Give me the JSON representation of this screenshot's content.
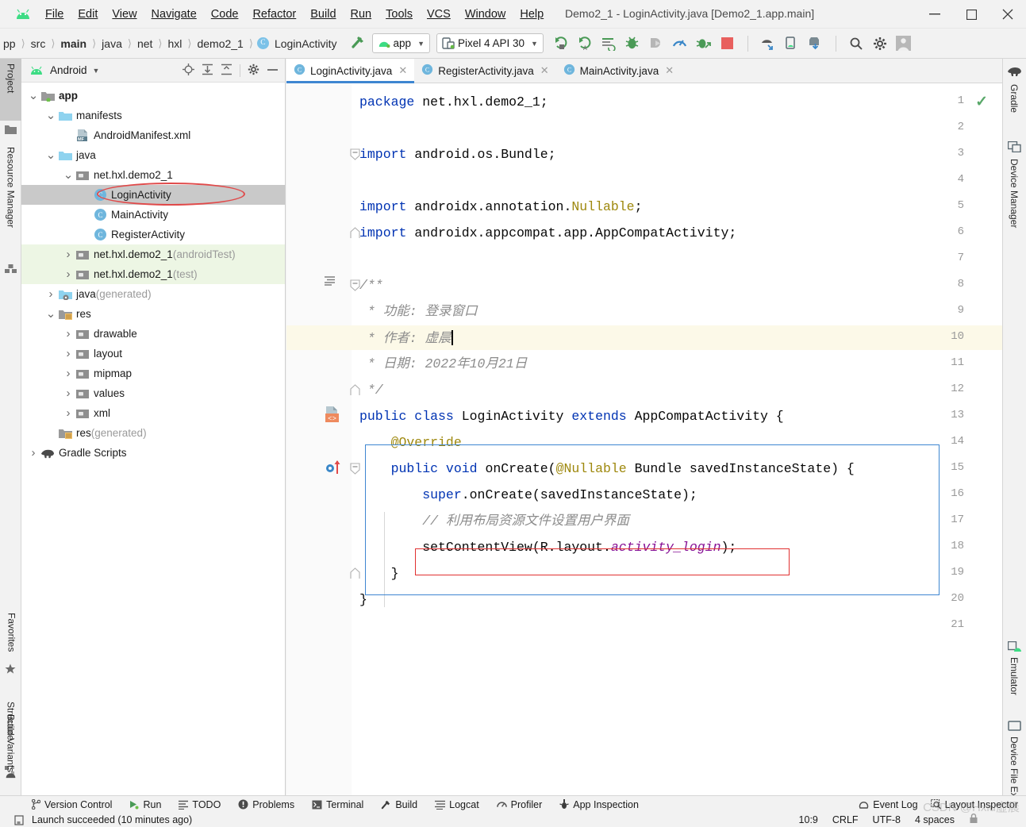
{
  "window": {
    "title": "Demo2_1 - LoginActivity.java [Demo2_1.app.main]",
    "minimize": "—",
    "maximize": "☐",
    "close": "✕"
  },
  "menubar": {
    "items": [
      {
        "label": "File"
      },
      {
        "label": "Edit"
      },
      {
        "label": "View"
      },
      {
        "label": "Navigate"
      },
      {
        "label": "Code"
      },
      {
        "label": "Refactor"
      },
      {
        "label": "Build"
      },
      {
        "label": "Run"
      },
      {
        "label": "Tools"
      },
      {
        "label": "VCS"
      },
      {
        "label": "Window"
      },
      {
        "label": "Help"
      }
    ]
  },
  "breadcrumb": {
    "items": [
      "pp",
      "src",
      "main",
      "java",
      "net",
      "hxl",
      "demo2_1",
      "LoginActivity"
    ],
    "class_badge": "C"
  },
  "toolbar": {
    "module_selector": "app",
    "device_selector": "Pixel 4 API 30",
    "icons": [
      "run-icon",
      "run-with-coverage-icon",
      "apply-changes-icon",
      "debug-icon",
      "attach-debugger-icon",
      "profiler-icon",
      "apply-code-changes-icon",
      "stop-icon",
      "sdk-manager-icon",
      "avd-manager-icon",
      "sync-gradle-icon",
      "search-icon",
      "settings-icon",
      "avatar-icon"
    ]
  },
  "left_tool_strip": {
    "tabs": [
      {
        "label": "Project",
        "icon": "project-icon",
        "selected": true
      },
      {
        "label": "Resource Manager",
        "icon": "resource-manager-icon",
        "selected": false
      },
      {
        "label": "Structure",
        "icon": "structure-icon",
        "selected": false
      },
      {
        "label": "Favorites",
        "icon": "star-icon",
        "selected": false
      },
      {
        "label": "Build Variants",
        "icon": "build-variants-icon",
        "selected": false
      }
    ]
  },
  "right_tool_strip": {
    "tabs": [
      {
        "label": "Gradle",
        "icon": "gradle-elephant-icon"
      },
      {
        "label": "Device Manager",
        "icon": "device-manager-icon"
      },
      {
        "label": "Emulator",
        "icon": "emulator-icon"
      },
      {
        "label": "Device File Explorer",
        "icon": "device-file-explorer-icon"
      }
    ]
  },
  "project_panel": {
    "header": {
      "title": "Android",
      "icons": [
        "locate-icon",
        "expand-all-icon",
        "collapse-all-icon",
        "gear-icon",
        "minimize-icon"
      ]
    },
    "tree": [
      {
        "label": "app",
        "suffix": "",
        "depth": 0,
        "arrow": "v",
        "icon": "module-folder-icon",
        "bold": true,
        "selected": false,
        "test": false
      },
      {
        "label": "manifests",
        "suffix": "",
        "depth": 1,
        "arrow": "v",
        "icon": "folder-icon",
        "bold": false,
        "selected": false,
        "test": false
      },
      {
        "label": "AndroidManifest.xml",
        "suffix": "",
        "depth": 2,
        "arrow": "",
        "icon": "manifest-file-icon",
        "bold": false,
        "selected": false,
        "test": false
      },
      {
        "label": "java",
        "suffix": "",
        "depth": 1,
        "arrow": "v",
        "icon": "folder-icon",
        "bold": false,
        "selected": false,
        "test": false
      },
      {
        "label": "net.hxl.demo2_1",
        "suffix": "",
        "depth": 2,
        "arrow": "v",
        "icon": "package-icon",
        "bold": false,
        "selected": false,
        "test": false
      },
      {
        "label": "LoginActivity",
        "suffix": "",
        "depth": 3,
        "arrow": "",
        "icon": "class-icon",
        "bold": false,
        "selected": true,
        "test": false
      },
      {
        "label": "MainActivity",
        "suffix": "",
        "depth": 3,
        "arrow": "",
        "icon": "class-icon",
        "bold": false,
        "selected": false,
        "test": false
      },
      {
        "label": "RegisterActivity",
        "suffix": "",
        "depth": 3,
        "arrow": "",
        "icon": "class-icon",
        "bold": false,
        "selected": false,
        "test": false
      },
      {
        "label": "net.hxl.demo2_1",
        "suffix": " (androidTest)",
        "depth": 2,
        "arrow": ">",
        "icon": "package-icon",
        "bold": false,
        "selected": false,
        "test": true
      },
      {
        "label": "net.hxl.demo2_1",
        "suffix": " (test)",
        "depth": 2,
        "arrow": ">",
        "icon": "package-icon",
        "bold": false,
        "selected": false,
        "test": true
      },
      {
        "label": "java",
        "suffix": " (generated)",
        "depth": 1,
        "arrow": ">",
        "icon": "generated-folder-icon",
        "bold": false,
        "selected": false,
        "test": false
      },
      {
        "label": "res",
        "suffix": "",
        "depth": 1,
        "arrow": "v",
        "icon": "res-folder-icon",
        "bold": false,
        "selected": false,
        "test": false
      },
      {
        "label": "drawable",
        "suffix": "",
        "depth": 2,
        "arrow": ">",
        "icon": "package-icon",
        "bold": false,
        "selected": false,
        "test": false
      },
      {
        "label": "layout",
        "suffix": "",
        "depth": 2,
        "arrow": ">",
        "icon": "package-icon",
        "bold": false,
        "selected": false,
        "test": false
      },
      {
        "label": "mipmap",
        "suffix": "",
        "depth": 2,
        "arrow": ">",
        "icon": "package-icon",
        "bold": false,
        "selected": false,
        "test": false
      },
      {
        "label": "values",
        "suffix": "",
        "depth": 2,
        "arrow": ">",
        "icon": "package-icon",
        "bold": false,
        "selected": false,
        "test": false
      },
      {
        "label": "xml",
        "suffix": "",
        "depth": 2,
        "arrow": ">",
        "icon": "package-icon",
        "bold": false,
        "selected": false,
        "test": false
      },
      {
        "label": "res",
        "suffix": " (generated)",
        "depth": 1,
        "arrow": "",
        "icon": "res-folder-icon",
        "bold": false,
        "selected": false,
        "test": false
      },
      {
        "label": "Gradle Scripts",
        "suffix": "",
        "depth": 0,
        "arrow": ">",
        "icon": "gradle-elephant-icon",
        "bold": false,
        "selected": false,
        "test": false
      }
    ]
  },
  "editor": {
    "tabs": [
      {
        "label": "LoginActivity.java",
        "active": true,
        "close": "✕"
      },
      {
        "label": "RegisterActivity.java",
        "active": false,
        "close": "✕"
      },
      {
        "label": "MainActivity.java",
        "active": false,
        "close": "✕"
      }
    ],
    "highlighted_line": 10,
    "inspection_status": "ok-check-icon",
    "lines": [
      {
        "n": 1,
        "fold": "",
        "gutter": "",
        "tokens": [
          {
            "t": "package ",
            "c": "kw"
          },
          {
            "t": "net.hxl.demo2_1;",
            "c": "pln"
          }
        ]
      },
      {
        "n": 2,
        "fold": "",
        "gutter": "",
        "tokens": []
      },
      {
        "n": 3,
        "fold": "-",
        "gutter": "",
        "tokens": [
          {
            "t": "import ",
            "c": "kw"
          },
          {
            "t": "android.os.Bundle;",
            "c": "pln"
          }
        ]
      },
      {
        "n": 4,
        "fold": "",
        "gutter": "",
        "tokens": []
      },
      {
        "n": 5,
        "fold": "",
        "gutter": "",
        "tokens": [
          {
            "t": "import ",
            "c": "kw"
          },
          {
            "t": "androidx.annotation.",
            "c": "pln"
          },
          {
            "t": "Nullable",
            "c": "ann"
          },
          {
            "t": ";",
            "c": "pln"
          }
        ]
      },
      {
        "n": 6,
        "fold": "^",
        "gutter": "",
        "tokens": [
          {
            "t": "import ",
            "c": "kw"
          },
          {
            "t": "androidx.appcompat.app.AppCompatActivity;",
            "c": "pln"
          }
        ]
      },
      {
        "n": 7,
        "fold": "",
        "gutter": "",
        "tokens": []
      },
      {
        "n": 8,
        "fold": "-",
        "gutter": "javadoc-icon",
        "tokens": [
          {
            "t": "/**",
            "c": "cmt"
          }
        ]
      },
      {
        "n": 9,
        "fold": "",
        "gutter": "",
        "tokens": [
          {
            "t": " * 功能: 登录窗口",
            "c": "cmt"
          }
        ]
      },
      {
        "n": 10,
        "fold": "",
        "gutter": "",
        "tokens": [
          {
            "t": " * 作者: 虚晨",
            "c": "cmt"
          }
        ],
        "caret": true
      },
      {
        "n": 11,
        "fold": "",
        "gutter": "",
        "tokens": [
          {
            "t": " * 日期: 2022年10月21日",
            "c": "cmt"
          }
        ]
      },
      {
        "n": 12,
        "fold": "^",
        "gutter": "",
        "tokens": [
          {
            "t": " */",
            "c": "cmt"
          }
        ]
      },
      {
        "n": 13,
        "fold": "",
        "gutter": "layout-resource-icon",
        "tokens": [
          {
            "t": "public class ",
            "c": "kw"
          },
          {
            "t": "LoginActivity ",
            "c": "pln"
          },
          {
            "t": "extends ",
            "c": "kw"
          },
          {
            "t": "AppCompatActivity {",
            "c": "pln"
          }
        ]
      },
      {
        "n": 14,
        "fold": "",
        "gutter": "",
        "tokens": [
          {
            "t": "    @Override",
            "c": "ann"
          }
        ]
      },
      {
        "n": 15,
        "fold": "-",
        "gutter": "overriding-method-icon",
        "tokens": [
          {
            "t": "    public void ",
            "c": "kw"
          },
          {
            "t": "onCreate(",
            "c": "pln"
          },
          {
            "t": "@Nullable ",
            "c": "ann"
          },
          {
            "t": "Bundle savedInstanceState) {",
            "c": "pln"
          }
        ]
      },
      {
        "n": 16,
        "fold": "",
        "gutter": "",
        "tokens": [
          {
            "t": "        ",
            "c": "pln"
          },
          {
            "t": "super",
            "c": "kw"
          },
          {
            "t": ".onCreate(savedInstanceState);",
            "c": "pln"
          }
        ]
      },
      {
        "n": 17,
        "fold": "",
        "gutter": "",
        "tokens": [
          {
            "t": "        // 利用布局资源文件设置用户界面",
            "c": "cmt"
          }
        ]
      },
      {
        "n": 18,
        "fold": "",
        "gutter": "",
        "tokens": [
          {
            "t": "        setContentView(R.layout.",
            "c": "pln"
          },
          {
            "t": "activity_login",
            "c": "fld"
          },
          {
            "t": ");",
            "c": "pln"
          }
        ]
      },
      {
        "n": 19,
        "fold": "^",
        "gutter": "",
        "tokens": [
          {
            "t": "    }",
            "c": "pln"
          }
        ]
      },
      {
        "n": 20,
        "fold": "",
        "gutter": "",
        "tokens": [
          {
            "t": "}",
            "c": "pln"
          }
        ]
      },
      {
        "n": 21,
        "fold": "",
        "gutter": "",
        "tokens": []
      }
    ]
  },
  "statusbar": {
    "left_items": [
      {
        "label": "Version Control",
        "icon": "branch-icon"
      },
      {
        "label": "Run",
        "icon": "run-icon"
      },
      {
        "label": "TODO",
        "icon": "todo-icon"
      },
      {
        "label": "Problems",
        "icon": "problems-icon"
      },
      {
        "label": "Terminal",
        "icon": "terminal-icon"
      },
      {
        "label": "Build",
        "icon": "build-hammer-icon"
      },
      {
        "label": "Logcat",
        "icon": "logcat-icon"
      },
      {
        "label": "Profiler",
        "icon": "profiler-icon"
      },
      {
        "label": "App Inspection",
        "icon": "app-inspection-icon"
      }
    ],
    "right_items": [
      {
        "label": "Event Log",
        "icon": "event-log-icon"
      },
      {
        "label": "Layout Inspector",
        "icon": "layout-inspector-icon"
      }
    ],
    "message": "Launch succeeded (10 minutes ago)",
    "message_icon": "notification-icon",
    "caret_position": "10:9",
    "line_separator": "CRLF",
    "encoding": "UTF-8",
    "indent": "4 spaces"
  },
  "watermark": "CSDN @Hxiu虚晨",
  "colors": {
    "accent": "#3e86d1",
    "keyword": "#0033b3",
    "annotation": "#9e880d",
    "comment": "#8c8c8c",
    "field": "#871094",
    "highlight_box": "#e03030",
    "selection": "#c9c9c9",
    "test_bg": "#edf6e4"
  }
}
